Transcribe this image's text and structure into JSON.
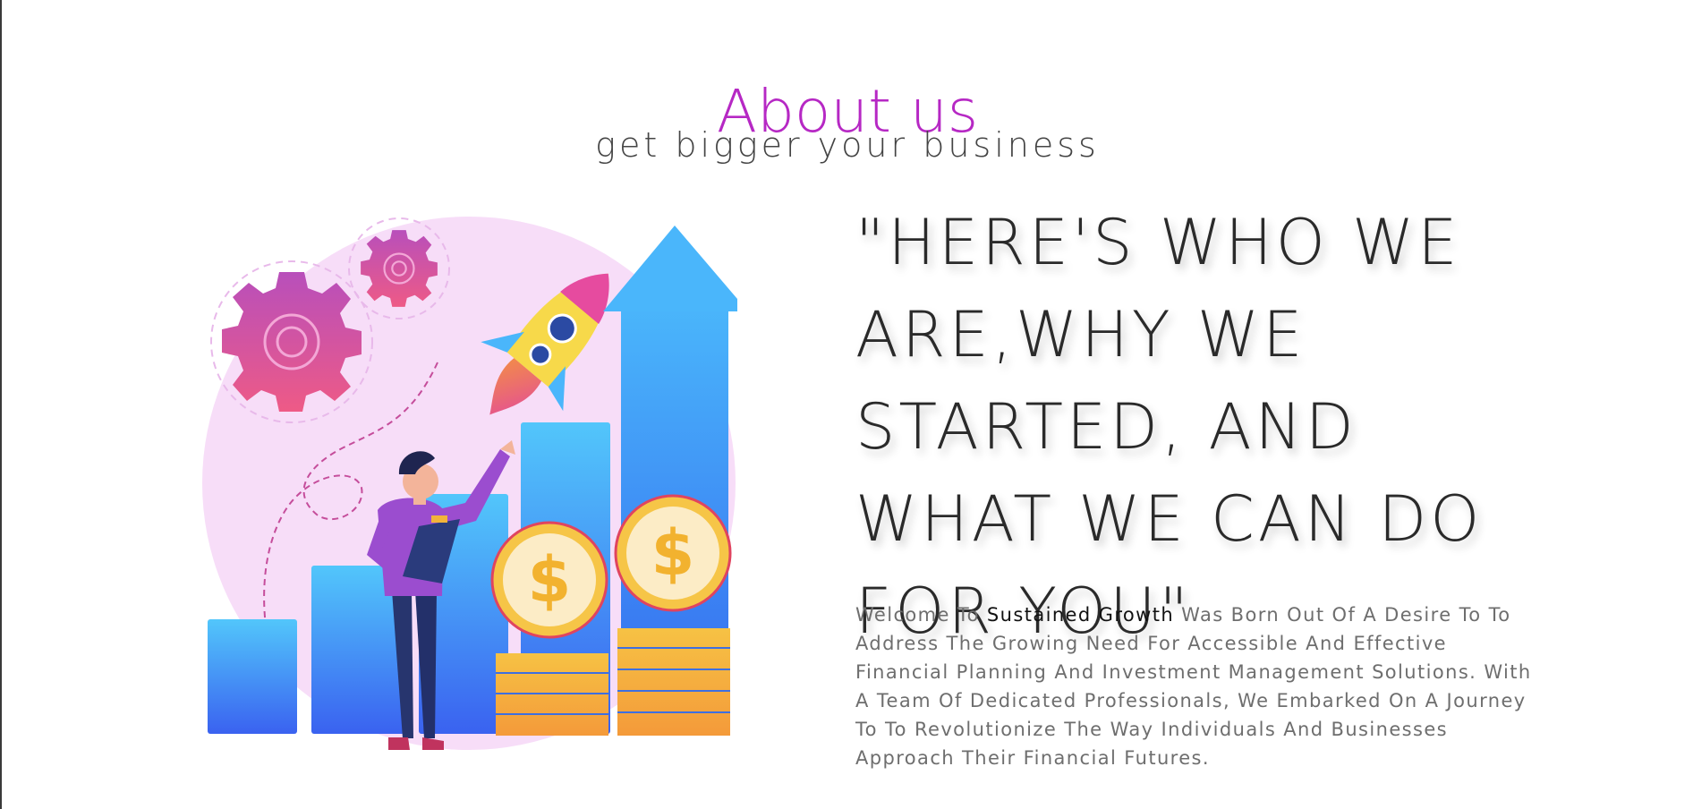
{
  "header": {
    "title": "About us",
    "subtitle": "get bigger your business"
  },
  "main": {
    "headline": "\"HERE'S WHO WE ARE,WHY WE STARTED, AND WHAT WE CAN DO FOR YOU\"",
    "paragraph_prefix": "Welcome To ",
    "brand": "Sustained Growth",
    "paragraph_rest": " Was Born Out Of A Desire To To Address The Growing Need For Accessible And Effective Financial Planning And Investment Management Solutions. With A Team Of Dedicated Professionals, We Embarked On A Journey To To Revolutionize The Way Individuals And Businesses Approach Their Financial Futures."
  },
  "illustration": {
    "icon_name": "growth-illustration",
    "coin_symbol": "$",
    "colors": {
      "circle_bg": "#f6dcf7",
      "bar": "#3e8ff6",
      "bar_light": "#52c6fb",
      "gear": "#d95aa6",
      "coin": "#f7b733",
      "rocket": "#f4d64a",
      "person_shirt": "#9b4dcf",
      "person_pants": "#27356e"
    }
  },
  "theme": {
    "title_color": "#b628c4",
    "text_color": "#2a2a2a",
    "paragraph_color": "#6e6e6e"
  }
}
